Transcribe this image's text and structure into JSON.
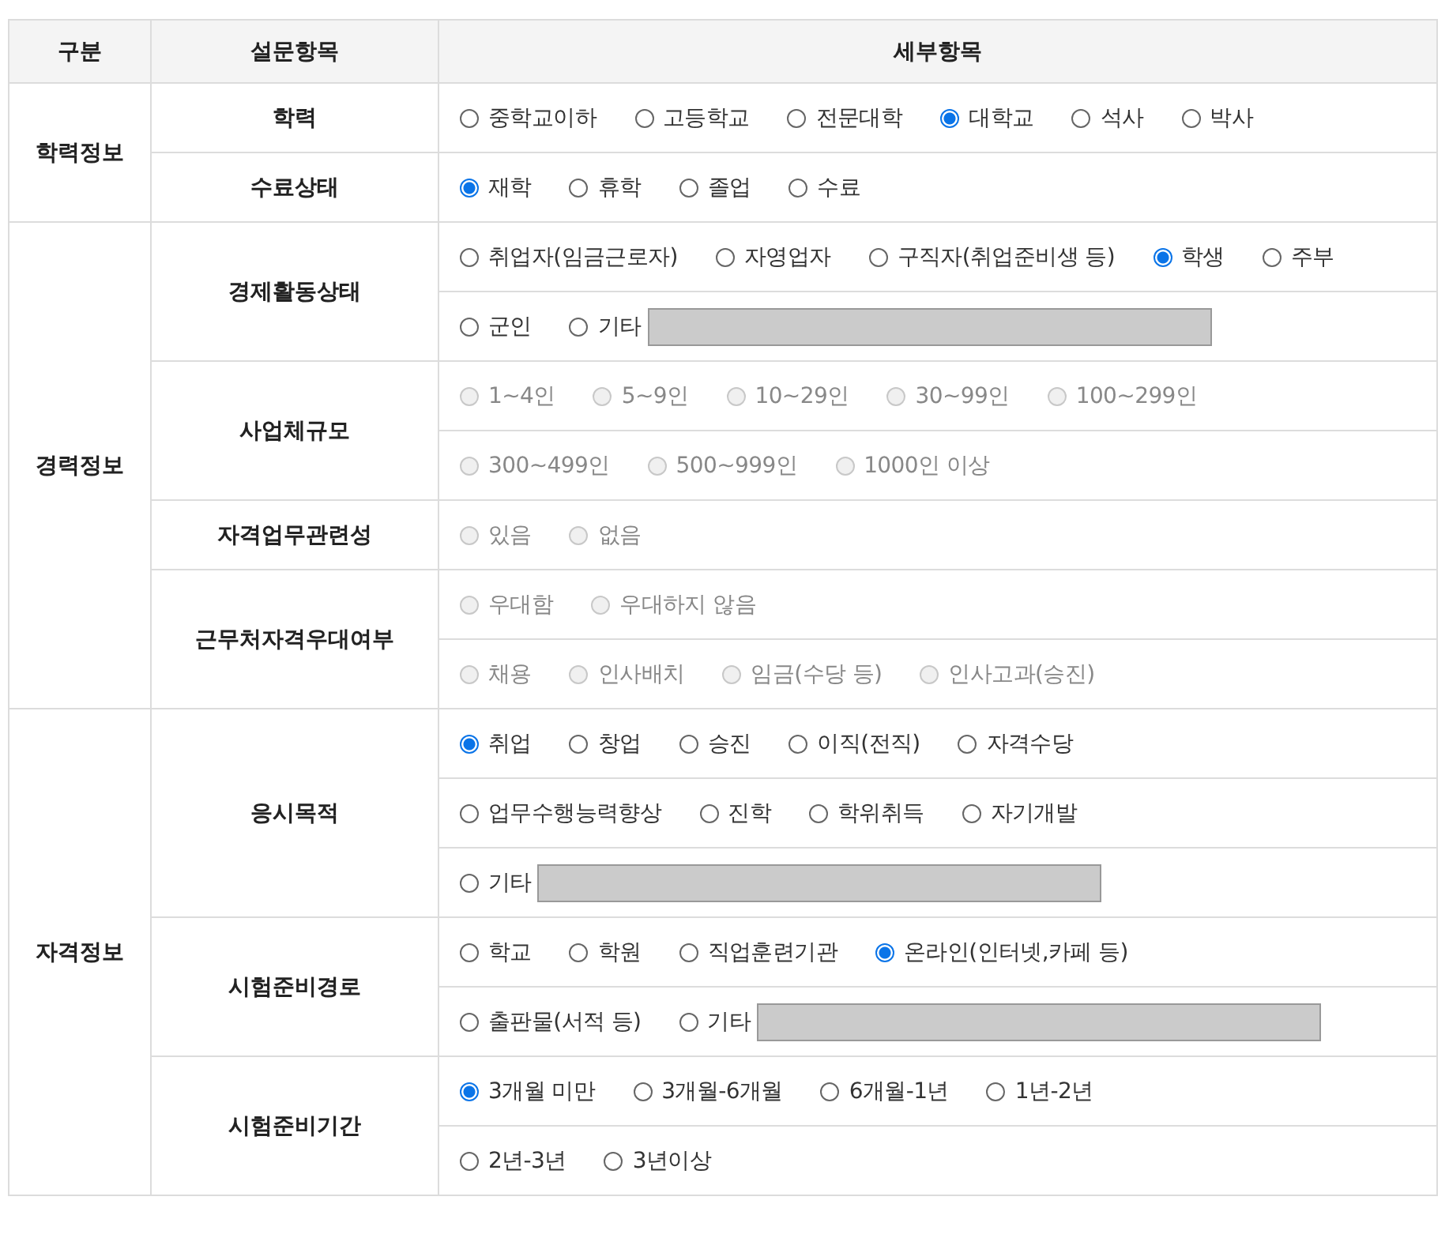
{
  "columns": [
    "구분",
    "설문항목",
    "세부항목"
  ],
  "sections": [
    {
      "label": "학력정보",
      "questions": [
        {
          "label": "학력",
          "lines": [
            [
              {
                "kind": "radio",
                "label": "중학교이하",
                "selected": false,
                "disabled": false
              },
              {
                "kind": "radio",
                "label": "고등학교",
                "selected": false,
                "disabled": false
              },
              {
                "kind": "radio",
                "label": "전문대학",
                "selected": false,
                "disabled": false
              },
              {
                "kind": "radio",
                "label": "대학교",
                "selected": true,
                "disabled": false
              },
              {
                "kind": "radio",
                "label": "석사",
                "selected": false,
                "disabled": false
              },
              {
                "kind": "radio",
                "label": "박사",
                "selected": false,
                "disabled": false
              }
            ]
          ]
        },
        {
          "label": "수료상태",
          "lines": [
            [
              {
                "kind": "radio",
                "label": "재학",
                "selected": true,
                "disabled": false
              },
              {
                "kind": "radio",
                "label": "휴학",
                "selected": false,
                "disabled": false
              },
              {
                "kind": "radio",
                "label": "졸업",
                "selected": false,
                "disabled": false
              },
              {
                "kind": "radio",
                "label": "수료",
                "selected": false,
                "disabled": false
              }
            ]
          ]
        }
      ]
    },
    {
      "label": "경력정보",
      "questions": [
        {
          "label": "경제활동상태",
          "lines": [
            [
              {
                "kind": "radio",
                "label": "취업자(임금근로자)",
                "selected": false,
                "disabled": false
              },
              {
                "kind": "radio",
                "label": "자영업자",
                "selected": false,
                "disabled": false
              },
              {
                "kind": "radio",
                "label": "구직자(취업준비생 등)",
                "selected": false,
                "disabled": false
              },
              {
                "kind": "radio",
                "label": "학생",
                "selected": true,
                "disabled": false
              },
              {
                "kind": "radio",
                "label": "주부",
                "selected": false,
                "disabled": false
              }
            ],
            [
              {
                "kind": "radio",
                "label": "군인",
                "selected": false,
                "disabled": false
              },
              {
                "kind": "radio",
                "label": "기타",
                "selected": false,
                "disabled": false
              },
              {
                "kind": "field",
                "disabled": true
              }
            ]
          ]
        },
        {
          "label": "사업체규모",
          "lines": [
            [
              {
                "kind": "radio",
                "label": "1~4인",
                "selected": false,
                "disabled": true
              },
              {
                "kind": "radio",
                "label": "5~9인",
                "selected": false,
                "disabled": true
              },
              {
                "kind": "radio",
                "label": "10~29인",
                "selected": false,
                "disabled": true
              },
              {
                "kind": "radio",
                "label": "30~99인",
                "selected": false,
                "disabled": true
              },
              {
                "kind": "radio",
                "label": "100~299인",
                "selected": false,
                "disabled": true
              }
            ],
            [
              {
                "kind": "radio",
                "label": "300~499인",
                "selected": false,
                "disabled": true
              },
              {
                "kind": "radio",
                "label": "500~999인",
                "selected": false,
                "disabled": true
              },
              {
                "kind": "radio",
                "label": "1000인 이상",
                "selected": false,
                "disabled": true
              }
            ]
          ]
        },
        {
          "label": "자격업무관련성",
          "lines": [
            [
              {
                "kind": "radio",
                "label": "있음",
                "selected": false,
                "disabled": true
              },
              {
                "kind": "radio",
                "label": "없음",
                "selected": false,
                "disabled": true
              }
            ]
          ]
        },
        {
          "label": "근무처자격우대여부",
          "lines": [
            [
              {
                "kind": "radio",
                "label": "우대함",
                "selected": false,
                "disabled": true
              },
              {
                "kind": "radio",
                "label": "우대하지 않음",
                "selected": false,
                "disabled": true
              }
            ],
            [
              {
                "kind": "radio",
                "label": "채용",
                "selected": false,
                "disabled": true
              },
              {
                "kind": "radio",
                "label": "인사배치",
                "selected": false,
                "disabled": true
              },
              {
                "kind": "radio",
                "label": "임금(수당 등)",
                "selected": false,
                "disabled": true
              },
              {
                "kind": "radio",
                "label": "인사고과(승진)",
                "selected": false,
                "disabled": true
              }
            ]
          ]
        }
      ]
    },
    {
      "label": "자격정보",
      "questions": [
        {
          "label": "응시목적",
          "lines": [
            [
              {
                "kind": "radio",
                "label": "취업",
                "selected": true,
                "disabled": false
              },
              {
                "kind": "radio",
                "label": "창업",
                "selected": false,
                "disabled": false
              },
              {
                "kind": "radio",
                "label": "승진",
                "selected": false,
                "disabled": false
              },
              {
                "kind": "radio",
                "label": "이직(전직)",
                "selected": false,
                "disabled": false
              },
              {
                "kind": "radio",
                "label": "자격수당",
                "selected": false,
                "disabled": false
              }
            ],
            [
              {
                "kind": "radio",
                "label": "업무수행능력향상",
                "selected": false,
                "disabled": false
              },
              {
                "kind": "radio",
                "label": "진학",
                "selected": false,
                "disabled": false
              },
              {
                "kind": "radio",
                "label": "학위취득",
                "selected": false,
                "disabled": false
              },
              {
                "kind": "radio",
                "label": "자기개발",
                "selected": false,
                "disabled": false
              }
            ],
            [
              {
                "kind": "radio",
                "label": "기타",
                "selected": false,
                "disabled": false
              },
              {
                "kind": "field",
                "disabled": true
              }
            ]
          ]
        },
        {
          "label": "시험준비경로",
          "lines": [
            [
              {
                "kind": "radio",
                "label": "학교",
                "selected": false,
                "disabled": false
              },
              {
                "kind": "radio",
                "label": "학원",
                "selected": false,
                "disabled": false
              },
              {
                "kind": "radio",
                "label": "직업훈련기관",
                "selected": false,
                "disabled": false
              },
              {
                "kind": "radio",
                "label": "온라인(인터넷,카페 등)",
                "selected": true,
                "disabled": false
              }
            ],
            [
              {
                "kind": "radio",
                "label": "출판물(서적 등)",
                "selected": false,
                "disabled": false
              },
              {
                "kind": "radio",
                "label": "기타",
                "selected": false,
                "disabled": false
              },
              {
                "kind": "field",
                "disabled": true
              }
            ]
          ]
        },
        {
          "label": "시험준비기간",
          "lines": [
            [
              {
                "kind": "radio",
                "label": "3개월 미만",
                "selected": true,
                "disabled": false
              },
              {
                "kind": "radio",
                "label": "3개월-6개월",
                "selected": false,
                "disabled": false
              },
              {
                "kind": "radio",
                "label": "6개월-1년",
                "selected": false,
                "disabled": false
              },
              {
                "kind": "radio",
                "label": "1년-2년",
                "selected": false,
                "disabled": false
              }
            ],
            [
              {
                "kind": "radio",
                "label": "2년-3년",
                "selected": false,
                "disabled": false
              },
              {
                "kind": "radio",
                "label": "3년이상",
                "selected": false,
                "disabled": false
              }
            ]
          ]
        }
      ]
    }
  ]
}
